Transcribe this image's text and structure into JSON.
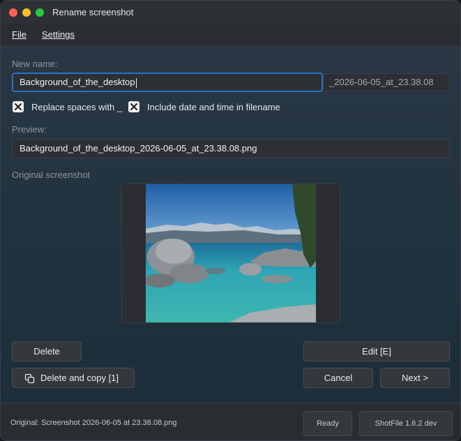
{
  "window": {
    "title": "Rename screenshot"
  },
  "menu": {
    "file": "File",
    "settings": "Settings"
  },
  "form": {
    "new_name_label": "New name:",
    "new_name_value": "Background_of_the_desktop",
    "date_suffix": "_2026-06-05_at_23.38.08",
    "replace_spaces_label": "Replace spaces with _",
    "replace_spaces_checked": true,
    "include_date_label": "Include date and time in filename",
    "include_date_checked": true,
    "preview_label": "Preview:",
    "preview_value": "Background_of_the_desktop_2026-06-05_at_23.38.08.png",
    "original_label": "Original screenshot"
  },
  "buttons": {
    "delete": "Delete",
    "delete_and_copy": "Delete and copy [1]",
    "edit": "Edit [E]",
    "cancel": "Cancel",
    "next": "Next >"
  },
  "status": {
    "original_file": "Original: Screenshot 2026-06-05 at 23.38.08.png",
    "state": "Ready",
    "version": "ShotFile 1.6.2 dev"
  },
  "icons": {
    "copy": "copy-icon",
    "checkbox": "check-x-icon"
  },
  "colors": {
    "accent": "#2c6fce",
    "close": "#fe5f57",
    "minimize": "#febc2e",
    "maximize": "#28c840"
  }
}
